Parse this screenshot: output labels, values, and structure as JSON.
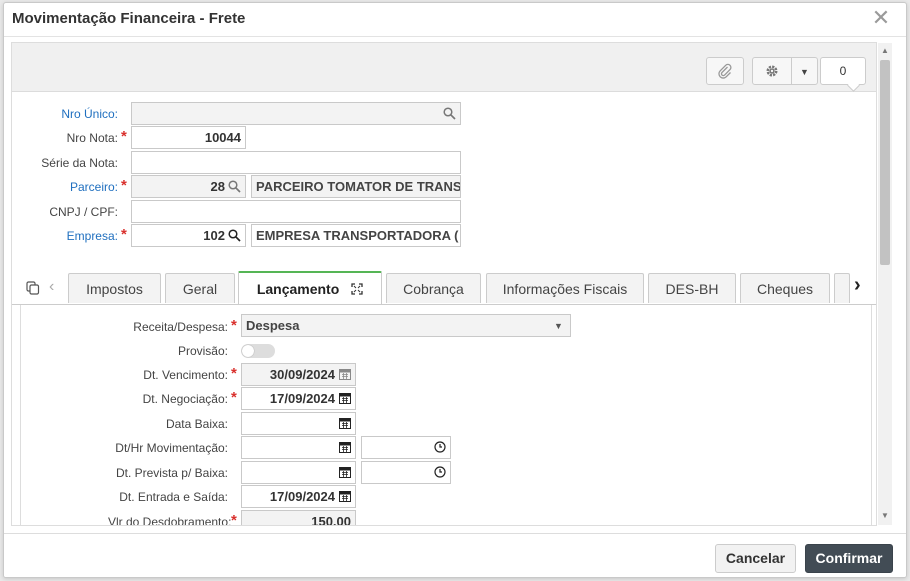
{
  "window": {
    "title": "Movimentação Financeira - Frete",
    "close_glyph": "✕"
  },
  "toolbar": {
    "badge_count": "0"
  },
  "header_fields": {
    "nro_unico": {
      "label": "Nro Único:",
      "value": ""
    },
    "nro_nota": {
      "label": "Nro Nota:",
      "value": "10044"
    },
    "serie_nota": {
      "label": "Série da Nota:",
      "value": ""
    },
    "parceiro": {
      "label": "Parceiro:",
      "code": "28",
      "name": "PARCEIRO TOMATOR DE TRANS"
    },
    "cnpj_cpf": {
      "label": "CNPJ / CPF:",
      "value": ""
    },
    "empresa": {
      "label": "Empresa:",
      "code": "102",
      "name": "EMPRESA TRANSPORTADORA ("
    }
  },
  "tabs": [
    {
      "label": "Impostos"
    },
    {
      "label": "Geral"
    },
    {
      "label": "Lançamento"
    },
    {
      "label": "Cobrança"
    },
    {
      "label": "Informações Fiscais"
    },
    {
      "label": "DES-BH"
    },
    {
      "label": "Cheques"
    }
  ],
  "lancamento": {
    "receita_despesa": {
      "label": "Receita/Despesa:",
      "value": "Despesa"
    },
    "provisao": {
      "label": "Provisão:",
      "on": false
    },
    "dt_vencimento": {
      "label": "Dt. Vencimento:",
      "value": "30/09/2024"
    },
    "dt_negociacao": {
      "label": "Dt. Negociação:",
      "value": "17/09/2024"
    },
    "data_baixa": {
      "label": "Data Baixa:",
      "value": ""
    },
    "dt_hr_movimentacao": {
      "label": "Dt/Hr Movimentação:",
      "date": "",
      "time": ""
    },
    "dt_prevista_baixa": {
      "label": "Dt. Prevista p/ Baixa:",
      "date": "",
      "time": ""
    },
    "dt_entrada_saida": {
      "label": "Dt. Entrada e Saída:",
      "value": "17/09/2024"
    },
    "vlr_desdobramento": {
      "label": "Vlr do Desdobramento:",
      "value": "150,00"
    }
  },
  "footer": {
    "cancel_label": "Cancelar",
    "confirm_label": "Confirmar"
  }
}
